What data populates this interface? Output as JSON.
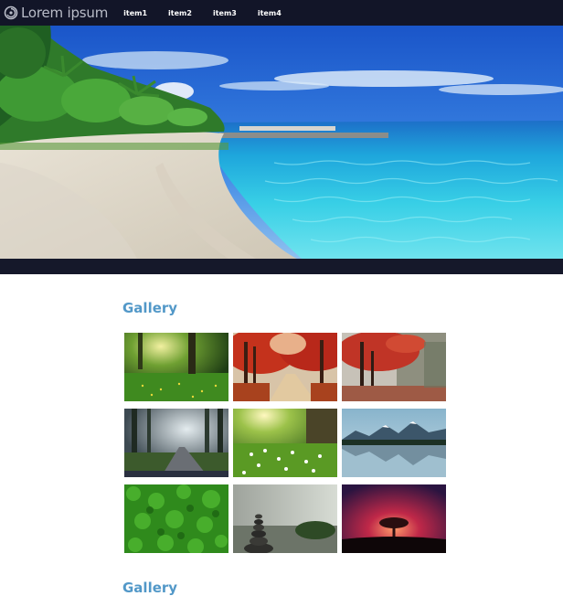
{
  "brand": {
    "name": "Lorem ipsum"
  },
  "nav": {
    "items": [
      {
        "label": "item1"
      },
      {
        "label": "item2"
      },
      {
        "label": "item3"
      },
      {
        "label": "item4"
      }
    ]
  },
  "hero": {
    "image": "tropical beach with turquoise water and palm trees"
  },
  "gallery_sections": [
    {
      "title": "Gallery"
    },
    {
      "title": "Gallery"
    }
  ],
  "gallery": {
    "images": [
      {
        "subject": "sunlit green meadow with trees"
      },
      {
        "subject": "red autumn forest path"
      },
      {
        "subject": "red tree in misty autumn forest"
      },
      {
        "subject": "foggy forest road"
      },
      {
        "subject": "sunlit meadow with white flowers"
      },
      {
        "subject": "mountain lake reflection"
      },
      {
        "subject": "green grass close-up"
      },
      {
        "subject": "stacked stones by misty river"
      },
      {
        "subject": "lone tree under red sunset sky"
      }
    ]
  },
  "colors": {
    "navbar": "#121528",
    "heading": "#5298c8",
    "background": "#ffffff"
  }
}
